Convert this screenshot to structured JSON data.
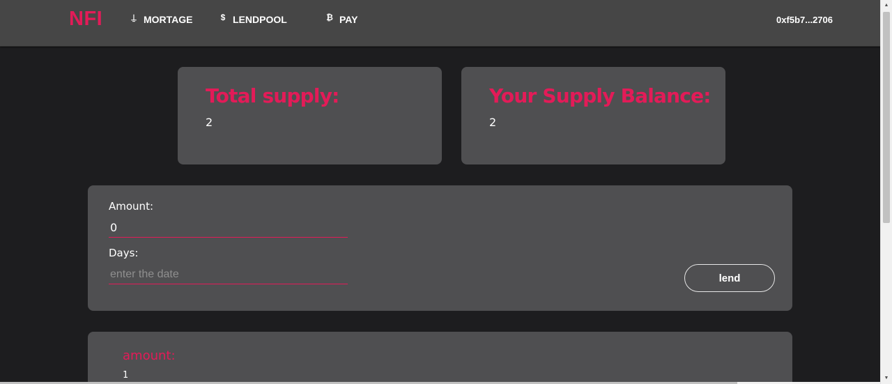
{
  "brand": {
    "logo_text": "NFI",
    "color": "#e31b58"
  },
  "nav": {
    "items": [
      {
        "label": "MORTAGE",
        "icon": "hand-coin-icon",
        "glyph": "⍊"
      },
      {
        "label": "LENDPOOL",
        "icon": "dollar-icon",
        "glyph": "$"
      },
      {
        "label": "PAY",
        "icon": "bitcoin-icon",
        "glyph": "₿"
      }
    ],
    "wallet_address": "0xf5b7...2706"
  },
  "stats": {
    "total_supply": {
      "title": "Total supply:",
      "value": "2"
    },
    "supply_balance": {
      "title": "Your Supply Balance:",
      "value": "2"
    }
  },
  "lend_form": {
    "amount_label": "Amount:",
    "amount_value": "0",
    "days_label": "Days:",
    "days_placeholder": "enter the date",
    "submit_label": "lend"
  },
  "record": {
    "label": "amount:",
    "value": "1"
  }
}
